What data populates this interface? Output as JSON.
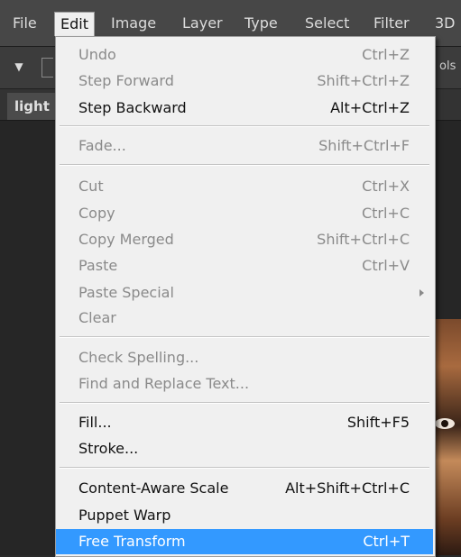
{
  "menubar": {
    "file": "File",
    "edit": "Edit",
    "image": "Image",
    "layer": "Layer",
    "type": "Type",
    "select": "Select",
    "filter": "Filter",
    "threed": "3D"
  },
  "options": {
    "right_text": "ols"
  },
  "document": {
    "tab_label": "light"
  },
  "edit_menu": {
    "undo": {
      "label": "Undo",
      "shortcut": "Ctrl+Z"
    },
    "step_forward": {
      "label": "Step Forward",
      "shortcut": "Shift+Ctrl+Z"
    },
    "step_backward": {
      "label": "Step Backward",
      "shortcut": "Alt+Ctrl+Z"
    },
    "fade": {
      "label": "Fade...",
      "shortcut": "Shift+Ctrl+F"
    },
    "cut": {
      "label": "Cut",
      "shortcut": "Ctrl+X"
    },
    "copy": {
      "label": "Copy",
      "shortcut": "Ctrl+C"
    },
    "copy_merged": {
      "label": "Copy Merged",
      "shortcut": "Shift+Ctrl+C"
    },
    "paste": {
      "label": "Paste",
      "shortcut": "Ctrl+V"
    },
    "paste_special": {
      "label": "Paste Special"
    },
    "clear": {
      "label": "Clear"
    },
    "check_spelling": {
      "label": "Check Spelling..."
    },
    "find_replace": {
      "label": "Find and Replace Text..."
    },
    "fill": {
      "label": "Fill...",
      "shortcut": "Shift+F5"
    },
    "stroke": {
      "label": "Stroke..."
    },
    "content_aware_scale": {
      "label": "Content-Aware Scale",
      "shortcut": "Alt+Shift+Ctrl+C"
    },
    "puppet_warp": {
      "label": "Puppet Warp"
    },
    "free_transform": {
      "label": "Free Transform",
      "shortcut": "Ctrl+T"
    }
  },
  "colors": {
    "highlight": "#3399ff",
    "menu_bg": "#f0f0f0",
    "disabled_text": "#8a8a8a"
  }
}
